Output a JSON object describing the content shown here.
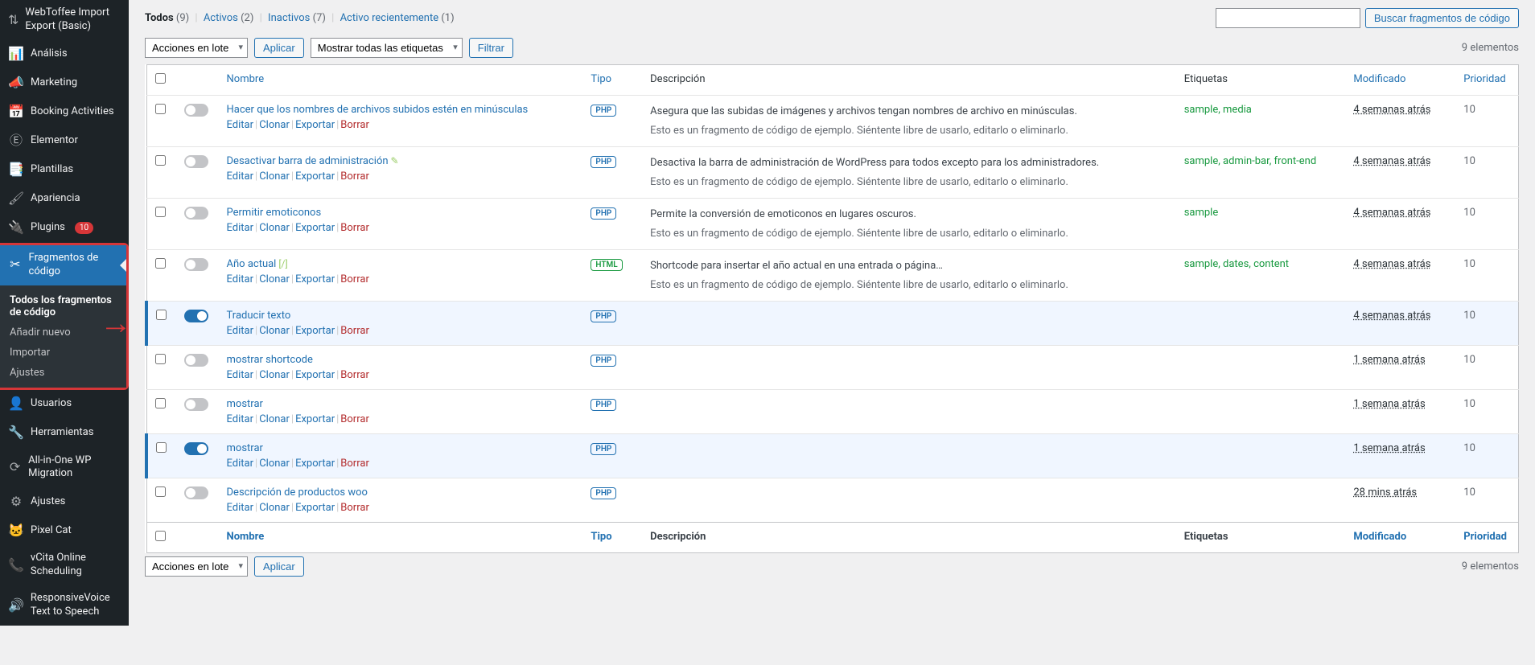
{
  "sidebar": {
    "items": [
      {
        "icon": "⇅",
        "label": "WebToffee Import Export (Basic)"
      },
      {
        "icon": "📊",
        "label": "Análisis"
      },
      {
        "icon": "📣",
        "label": "Marketing"
      },
      {
        "icon": "📅",
        "label": "Booking Activities"
      },
      {
        "icon": "Ⓔ",
        "label": "Elementor"
      },
      {
        "icon": "📑",
        "label": "Plantillas"
      },
      {
        "icon": "🖌",
        "label": "Apariencia"
      },
      {
        "icon": "🔌",
        "label": "Plugins",
        "badge": "10"
      },
      {
        "icon": "✂",
        "label": "Fragmentos de código",
        "active": true
      },
      {
        "icon": "👤",
        "label": "Usuarios"
      },
      {
        "icon": "🔧",
        "label": "Herramientas"
      },
      {
        "icon": "⟳",
        "label": "All-in-One WP Migration"
      },
      {
        "icon": "⚙",
        "label": "Ajustes"
      },
      {
        "icon": "🐱",
        "label": "Pixel Cat"
      },
      {
        "icon": "📞",
        "label": "vCita Online Scheduling"
      },
      {
        "icon": "🔊",
        "label": "ResponsiveVoice Text to Speech"
      }
    ],
    "sub": [
      {
        "label": "Todos los fragmentos de código",
        "current": true
      },
      {
        "label": "Añadir nuevo"
      },
      {
        "label": "Importar"
      },
      {
        "label": "Ajustes"
      }
    ]
  },
  "filters": {
    "all_label": "Todos",
    "all_count": "(9)",
    "active_label": "Activos",
    "active_count": "(2)",
    "inactive_label": "Inactivos",
    "inactive_count": "(7)",
    "recent_label": "Activo recientemente",
    "recent_count": "(1)"
  },
  "search": {
    "button": "Buscar fragmentos de código"
  },
  "bulk": {
    "label": "Acciones en lote"
  },
  "apply": "Aplicar",
  "tagfilter": "Mostrar todas las etiquetas",
  "filterbtn": "Filtrar",
  "elements_count": "9 elementos",
  "headers": {
    "name": "Nombre",
    "type": "Tipo",
    "desc": "Descripción",
    "tags": "Etiquetas",
    "mod": "Modificado",
    "pri": "Prioridad"
  },
  "rowactions": {
    "edit": "Editar",
    "clone": "Clonar",
    "export": "Exportar",
    "delete": "Borrar"
  },
  "rows": [
    {
      "title": "Hacer que los nombres de archivos subidos estén en minúsculas",
      "type": "PHP",
      "desc": "Asegura que las subidas de imágenes y archivos tengan nombres de archivo en minúsculas.",
      "note": "Esto es un fragmento de código de ejemplo. Siéntente libre de usarlo, editarlo o eliminarlo.",
      "tags": "sample, media",
      "mod": "4 semanas atrás",
      "pri": "10",
      "on": false
    },
    {
      "title": "Desactivar barra de administración",
      "dash": " ✎",
      "type": "PHP",
      "desc": "Desactiva la barra de administración de WordPress para todos excepto para los administradores.",
      "note": "Esto es un fragmento de código de ejemplo. Siéntente libre de usarlo, editarlo o eliminarlo.",
      "tags": "sample, admin-bar, front-end",
      "mod": "4 semanas atrás",
      "pri": "10",
      "on": false
    },
    {
      "title": "Permitir emoticonos",
      "type": "PHP",
      "desc": "Permite la conversión de emoticonos en lugares oscuros.",
      "note": "Esto es un fragmento de código de ejemplo. Siéntente libre de usarlo, editarlo o eliminarlo.",
      "tags": "sample",
      "mod": "4 semanas atrás",
      "pri": "10",
      "on": false
    },
    {
      "title": "Año actual",
      "dash": " [/]",
      "type": "HTML",
      "desc": "Shortcode para insertar el año actual en una entrada o página…",
      "note": "Esto es un fragmento de código de ejemplo. Siéntente libre de usarlo, editarlo o eliminarlo.",
      "tags": "sample, dates, content",
      "mod": "4 semanas atrás",
      "pri": "10",
      "on": false
    },
    {
      "title": "Traducir texto",
      "type": "PHP",
      "desc": "",
      "tags": "",
      "mod": "4 semanas atrás",
      "pri": "10",
      "on": true
    },
    {
      "title": "mostrar shortcode",
      "type": "PHP",
      "desc": "",
      "tags": "",
      "mod": "1 semana atrás",
      "pri": "10",
      "on": false
    },
    {
      "title": "mostrar",
      "type": "PHP",
      "desc": "",
      "tags": "",
      "mod": "1 semana atrás",
      "pri": "10",
      "on": false
    },
    {
      "title": "mostrar",
      "type": "PHP",
      "desc": "",
      "tags": "",
      "mod": "1 semana atrás",
      "pri": "10",
      "on": true
    },
    {
      "title": "Descripción de productos woo",
      "type": "PHP",
      "desc": "",
      "tags": "",
      "mod": "28 mins atrás",
      "pri": "10",
      "on": false
    }
  ]
}
